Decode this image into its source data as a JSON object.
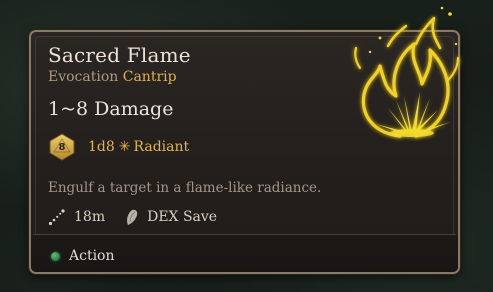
{
  "spell": {
    "name": "Sacred Flame",
    "school": "Evocation",
    "level": "Cantrip",
    "damage_title": "1~8 Damage",
    "dice": {
      "icon": "d8-icon",
      "number": "8",
      "roll": "1d8",
      "damage_type": "Radiant",
      "damage_type_icon": "radiant-icon"
    },
    "description": "Engulf a target in a flame-like radiance.",
    "range": "18m",
    "range_icon": "range-icon",
    "save": "DEX Save",
    "save_icon": "save-icon",
    "cost": "Action",
    "cost_icon": "action-dot-icon",
    "illustration_icon": "sacred-flame-icon"
  },
  "colors": {
    "title": "#ebe3d6",
    "school": "#b39a7e",
    "accent_gold": "#e3b446",
    "description": "#a39587",
    "border": "#8a7a62",
    "action_green": "#3fa35f"
  }
}
